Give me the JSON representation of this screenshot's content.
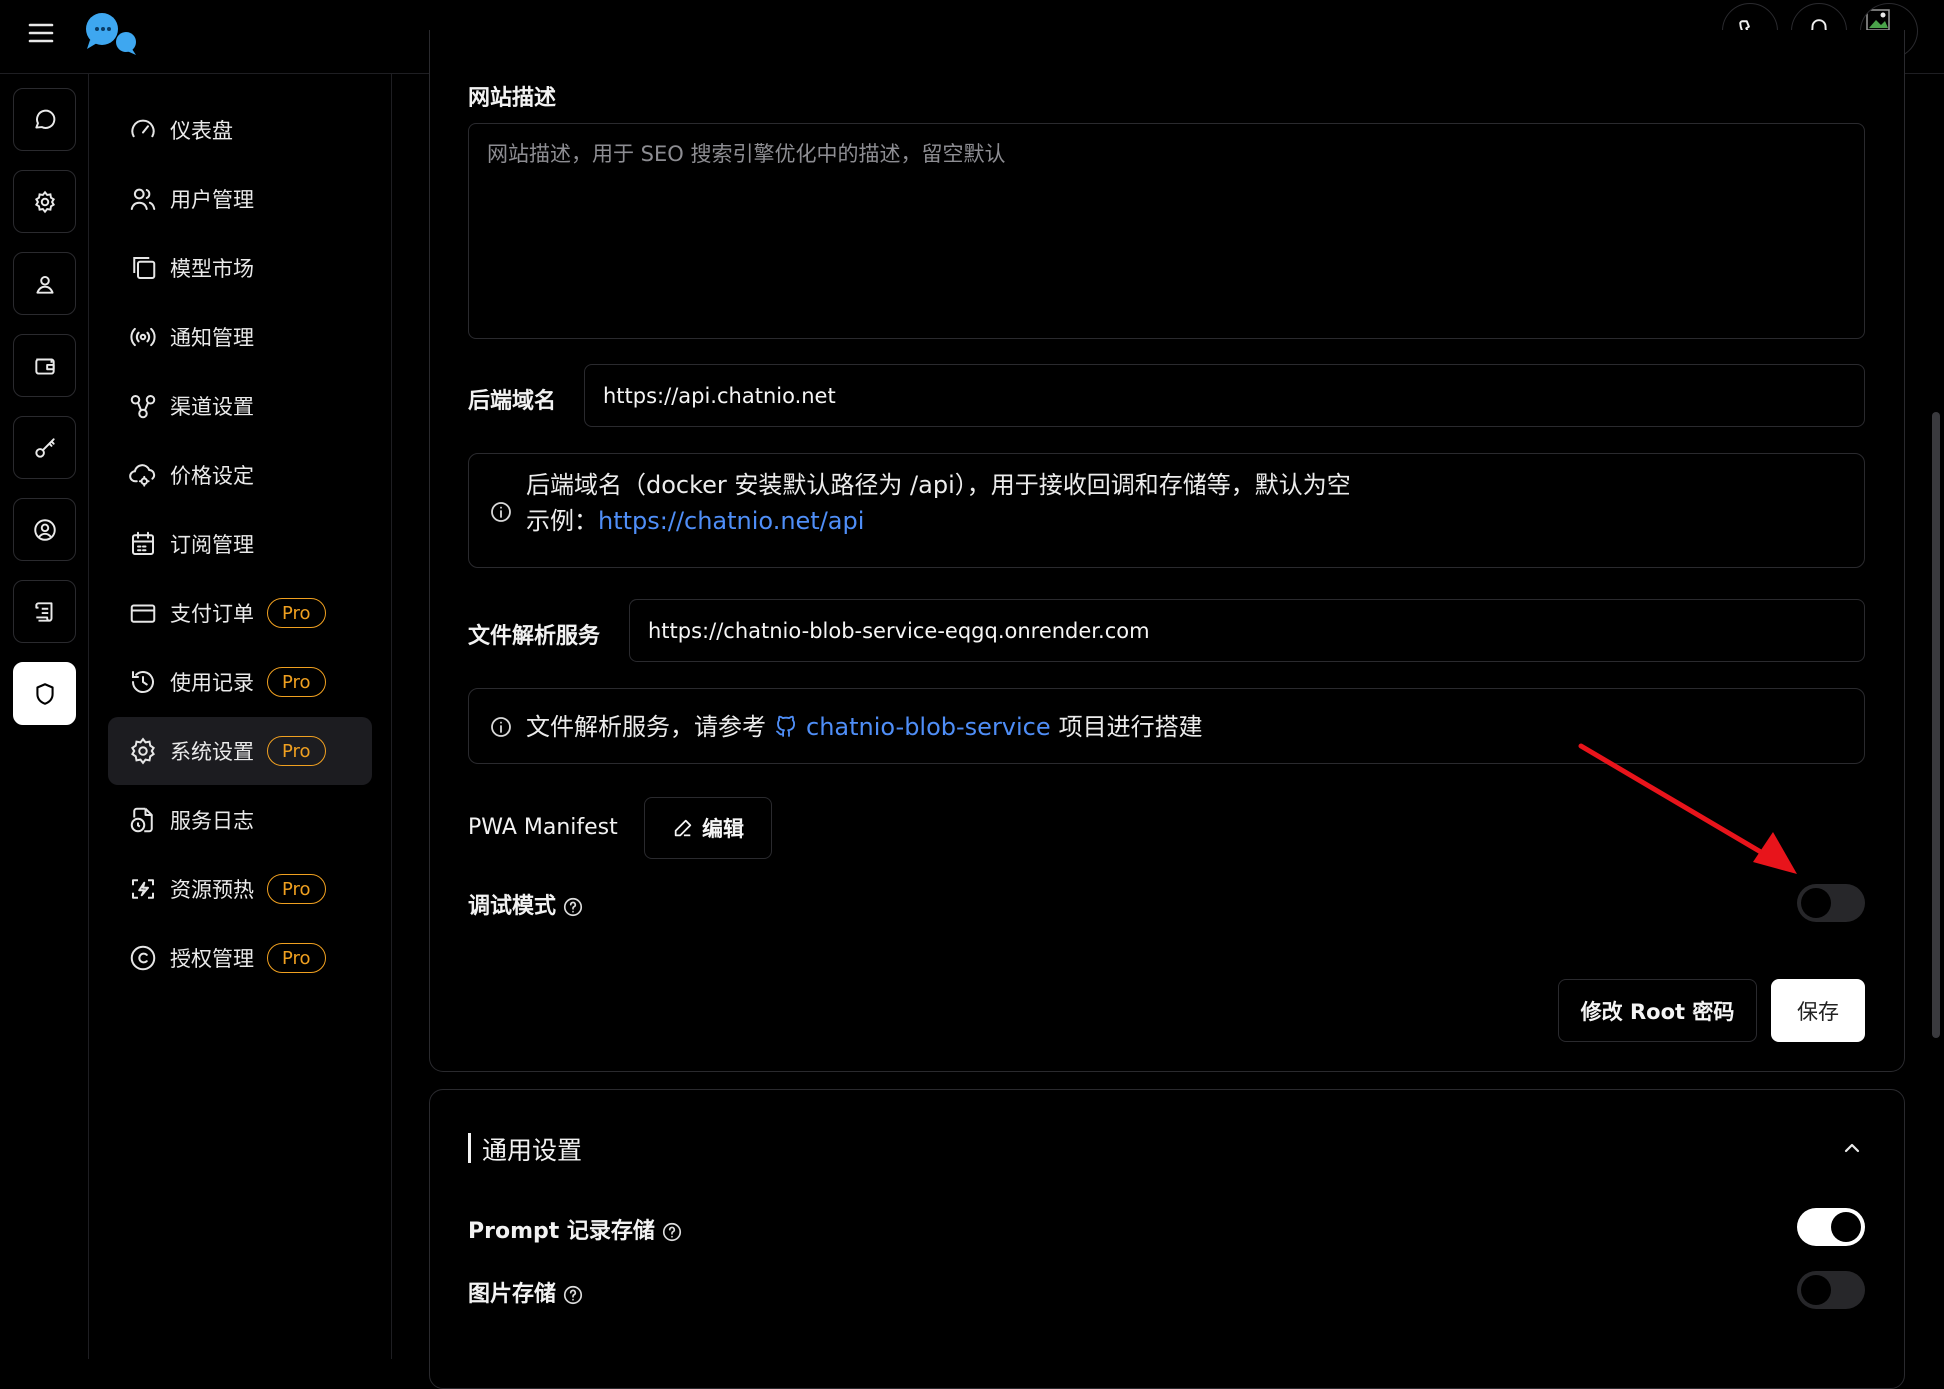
{
  "sidebar": {
    "items": [
      {
        "label": "仪表盘",
        "pro": ""
      },
      {
        "label": "用户管理",
        "pro": ""
      },
      {
        "label": "模型市场",
        "pro": ""
      },
      {
        "label": "通知管理",
        "pro": ""
      },
      {
        "label": "渠道设置",
        "pro": ""
      },
      {
        "label": "价格设定",
        "pro": ""
      },
      {
        "label": "订阅管理",
        "pro": ""
      },
      {
        "label": "支付订单",
        "pro": "Pro"
      },
      {
        "label": "使用记录",
        "pro": "Pro"
      },
      {
        "label": "系统设置",
        "pro": "Pro"
      },
      {
        "label": "服务日志",
        "pro": ""
      },
      {
        "label": "资源预热",
        "pro": "Pro"
      },
      {
        "label": "授权管理",
        "pro": "Pro"
      }
    ],
    "active_index": 9
  },
  "rail": {
    "active_index": 7
  },
  "main": {
    "site_description": {
      "label": "网站描述",
      "placeholder": "网站描述，用于 SEO 搜索引擎优化中的描述，留空默认"
    },
    "backend_domain": {
      "label": "后端域名",
      "value": "https://api.chatnio.net",
      "info_line1": "后端域名（docker 安装默认路径为 /api），用于接收回调和存储等，默认为空",
      "info_prefix": "示例：",
      "info_link": "https://chatnio.net/api"
    },
    "file_service": {
      "label": "文件解析服务",
      "value": "https://chatnio-blob-service-eqgq.onrender.com",
      "info_prefix": "文件解析服务，请参考",
      "info_link": "chatnio-blob-service",
      "info_suffix": "项目进行搭建"
    },
    "pwa": {
      "label": "PWA Manifest",
      "edit_label": "编辑"
    },
    "debug": {
      "label": "调试模式",
      "enabled": false
    },
    "actions": {
      "change_root": "修改 Root 密码",
      "save": "保存"
    },
    "general": {
      "title": "通用设置",
      "prompt_store": {
        "label": "Prompt 记录存储",
        "enabled": true
      },
      "image_store": {
        "label": "图片存储",
        "enabled": false
      }
    }
  },
  "colors": {
    "accent_pro": "#f0a020",
    "link": "#4f8ef7",
    "annotation_arrow": "#e8141b"
  }
}
